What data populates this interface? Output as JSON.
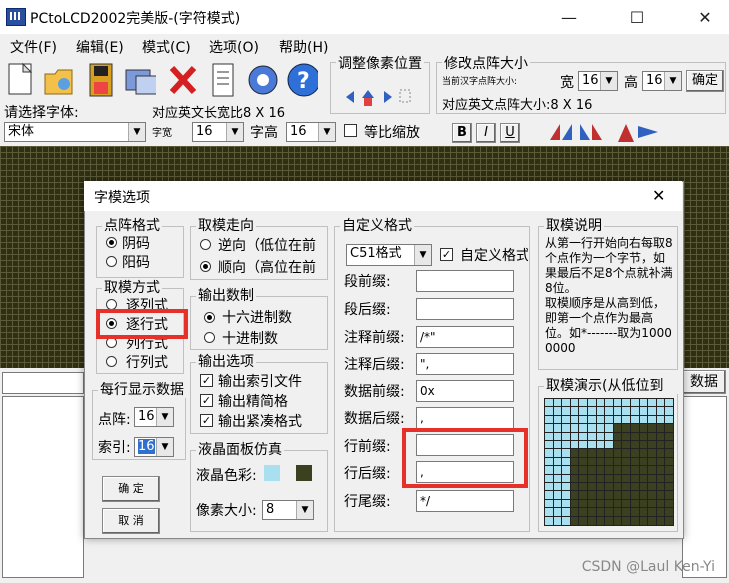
{
  "window": {
    "title": "PCtoLCD2002完美版-(字符模式)",
    "min": "—",
    "max": "☐",
    "close": "✕"
  },
  "menu": [
    "文件(F)",
    "编辑(E)",
    "模式(C)",
    "选项(O)",
    "帮助(H)"
  ],
  "toolbar": {
    "icons": [
      "new-icon",
      "open-icon",
      "save-icon",
      "settings-icon",
      "delete-icon",
      "notes-icon",
      "gear-icon",
      "help-icon"
    ],
    "pixel_adjust_label": "调整像素位置",
    "dot_size_label": "修改点阵大小",
    "current_font_label": "当前汉字点阵大小:",
    "width_label": "宽",
    "width_value": "16",
    "height_label": "高",
    "height_value": "16",
    "confirm_label": "确定",
    "en_size_text": "对应英文点阵大小:8 X 16",
    "choose_font_label": "请选择字体:",
    "en_ratio_text": "对应英文长宽比8 X 16",
    "font_value": "宋体",
    "char_width_label": "字宽",
    "char_width_value": "16",
    "char_height_label": "字高",
    "char_height_value": "16",
    "scale_label": "等比缩放",
    "bold": "B",
    "italic": "I",
    "underline": "U",
    "bg_input_label": "数据"
  },
  "dialog": {
    "title": "字模选项",
    "close": "✕",
    "dot_format": {
      "label": "点阵格式",
      "options": [
        "阴码",
        "阳码"
      ],
      "selected": 0
    },
    "mode": {
      "label": "取模方式",
      "options": [
        "逐列式",
        "逐行式",
        "列行式",
        "行列式"
      ],
      "selected": 1
    },
    "per_line": {
      "label": "每行显示数据",
      "dot_label": "点阵:",
      "dot_value": "16",
      "index_label": "索引:",
      "index_value": "16"
    },
    "direction": {
      "label": "取模走向",
      "options": [
        "逆向（低位在前",
        "顺向（高位在前"
      ],
      "selected": 1
    },
    "number_base": {
      "label": "输出数制",
      "options": [
        "十六进制数",
        "十进制数"
      ],
      "selected": 0
    },
    "output_opts": {
      "label": "输出选项",
      "options": [
        "输出索引文件",
        "输出精简格",
        "输出紧凑格式"
      ]
    },
    "lcd_sim": {
      "label": "液晶面板仿真",
      "color_label": "液晶色彩:",
      "pixel_label": "像素大小:",
      "pixel_value": "8",
      "color_on": "#a8e0f0",
      "color_off": "#3a4020"
    },
    "custom": {
      "label": "自定义格式",
      "format_value": "C51格式",
      "custom_check_label": "自定义格式",
      "rows": [
        {
          "label": "段前缀:",
          "value": ""
        },
        {
          "label": "段后缀:",
          "value": ""
        },
        {
          "label": "注释前缀:",
          "value": "/*\""
        },
        {
          "label": "注释后缀:",
          "value": "\","
        },
        {
          "label": "数据前缀:",
          "value": "0x"
        },
        {
          "label": "数据后缀:",
          "value": ","
        },
        {
          "label": "行前缀:",
          "value": ""
        },
        {
          "label": "行后缀:",
          "value": ","
        },
        {
          "label": "行尾缀:",
          "value": "*/"
        }
      ]
    },
    "explain": {
      "label": "取模说明",
      "text": "从第一行开始向右每取8个点作为一个字节，如果最后不足8个点就补满8位。\n取模顺序是从高到低，即第一个点作为最高位。如*-------取为10000000"
    },
    "demo": {
      "label": "取模演示(从低位到"
    },
    "ok_label": "确 定",
    "cancel_label": "取 消"
  },
  "watermark": "CSDN @Laul Ken-Yi"
}
